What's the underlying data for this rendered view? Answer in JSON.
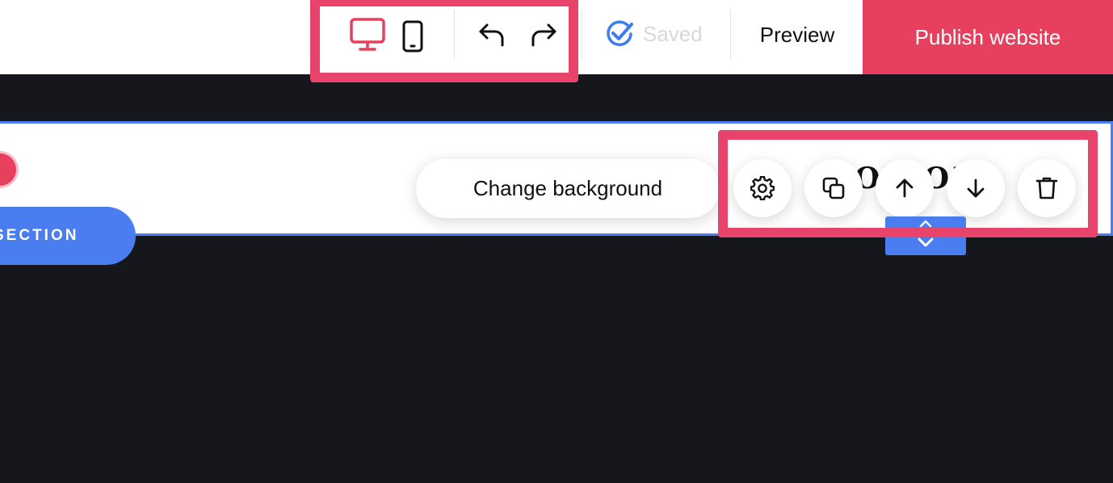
{
  "toolbar": {
    "saved_label": "Saved",
    "preview_label": "Preview",
    "publish_label": "Publish website",
    "icons": {
      "desktop": "monitor-icon",
      "mobile": "mobile-icon",
      "undo": "undo-icon",
      "redo": "redo-icon",
      "saved": "check-circle-icon"
    }
  },
  "section": {
    "title_fragment": "OR OF",
    "add_section_label": "SECTION",
    "change_background_label": "Change background",
    "actions": {
      "settings": "gear-icon",
      "duplicate": "copy-icon",
      "move_up": "arrow-up-icon",
      "move_down": "arrow-down-icon",
      "delete": "trash-icon"
    }
  },
  "colors": {
    "accent": "#e6405e",
    "highlight": "#e8436b",
    "blue": "#4a7df0",
    "canvas": "#16171c",
    "saved_check": "#3d7df0"
  }
}
